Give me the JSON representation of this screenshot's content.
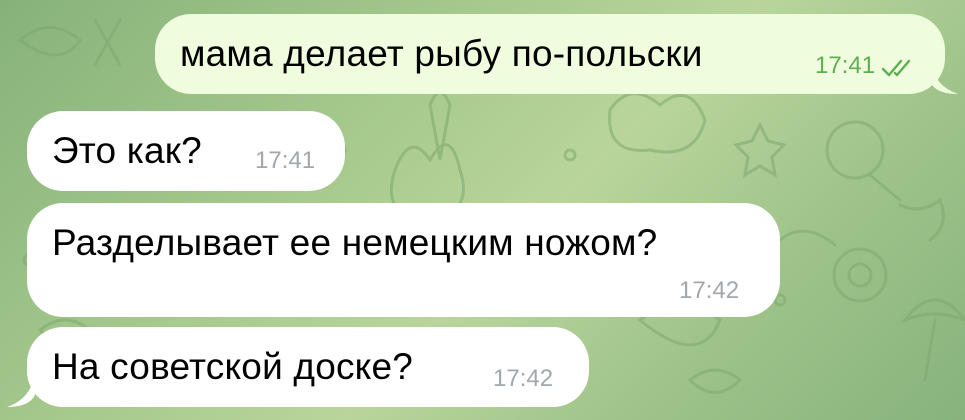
{
  "messages": [
    {
      "direction": "outgoing",
      "text": "мама делает рыбу по-польски",
      "time": "17:41",
      "status_icon": "double-check-icon",
      "status": "read"
    },
    {
      "direction": "incoming",
      "text": "Это как?",
      "time": "17:41"
    },
    {
      "direction": "incoming",
      "text": "Разделывает ее немецким ножом?",
      "time": "17:42"
    },
    {
      "direction": "incoming",
      "text": "На советской доске?",
      "time": "17:42"
    }
  ],
  "colors": {
    "wallpaper": "#9fc48a",
    "incoming_bubble": "#ffffff",
    "outgoing_bubble": "#effdde",
    "outgoing_time": "#5fae52",
    "incoming_time": "#a2a7ab"
  }
}
